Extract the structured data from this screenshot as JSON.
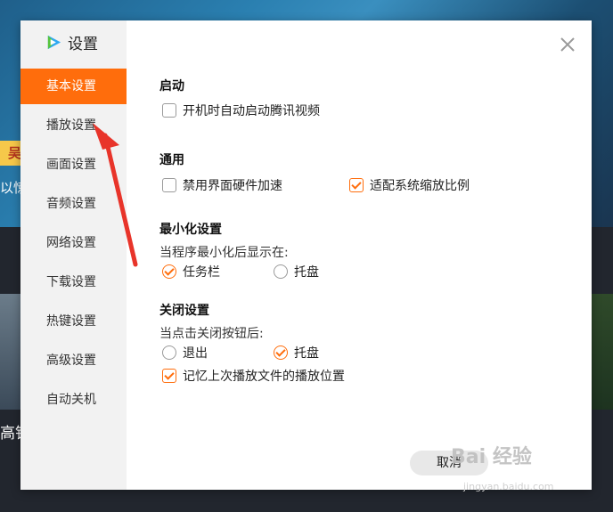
{
  "background": {
    "badge_text": "吴宣",
    "caption": "以惊",
    "left_text": "高铁"
  },
  "dialog": {
    "title": "设置",
    "icon": "tencent-video-logo-icon",
    "close_icon": "close-icon"
  },
  "sidebar": {
    "items": [
      {
        "label": "基本设置",
        "active": true
      },
      {
        "label": "播放设置",
        "active": false
      },
      {
        "label": "画面设置",
        "active": false
      },
      {
        "label": "音频设置",
        "active": false
      },
      {
        "label": "网络设置",
        "active": false
      },
      {
        "label": "下载设置",
        "active": false
      },
      {
        "label": "热键设置",
        "active": false
      },
      {
        "label": "高级设置",
        "active": false
      },
      {
        "label": "自动关机",
        "active": false
      }
    ]
  },
  "sections": {
    "startup": {
      "title": "启动",
      "auto_start": {
        "label": "开机时自动启动腾讯视频",
        "checked": false
      }
    },
    "general": {
      "title": "通用",
      "disable_hw_accel": {
        "label": "禁用界面硬件加速",
        "checked": false
      },
      "system_scaling": {
        "label": "适配系统缩放比例",
        "checked": true
      }
    },
    "minimize": {
      "title": "最小化设置",
      "description": "当程序最小化后显示在:",
      "taskbar": {
        "label": "任务栏",
        "selected": true
      },
      "tray": {
        "label": "托盘",
        "selected": false
      }
    },
    "close": {
      "title": "关闭设置",
      "description": "当点击关闭按钮后:",
      "exit": {
        "label": "退出",
        "selected": false
      },
      "tray": {
        "label": "托盘",
        "selected": true
      },
      "remember_position": {
        "label": "记忆上次播放文件的播放位置",
        "checked": true
      }
    }
  },
  "footer": {
    "cancel_label": "取消"
  },
  "watermark": {
    "text": "Bai 经验",
    "url": "jingyan.baidu.com"
  },
  "colors": {
    "accent": "#ff6d0c",
    "annotation_arrow": "#e8342a"
  }
}
